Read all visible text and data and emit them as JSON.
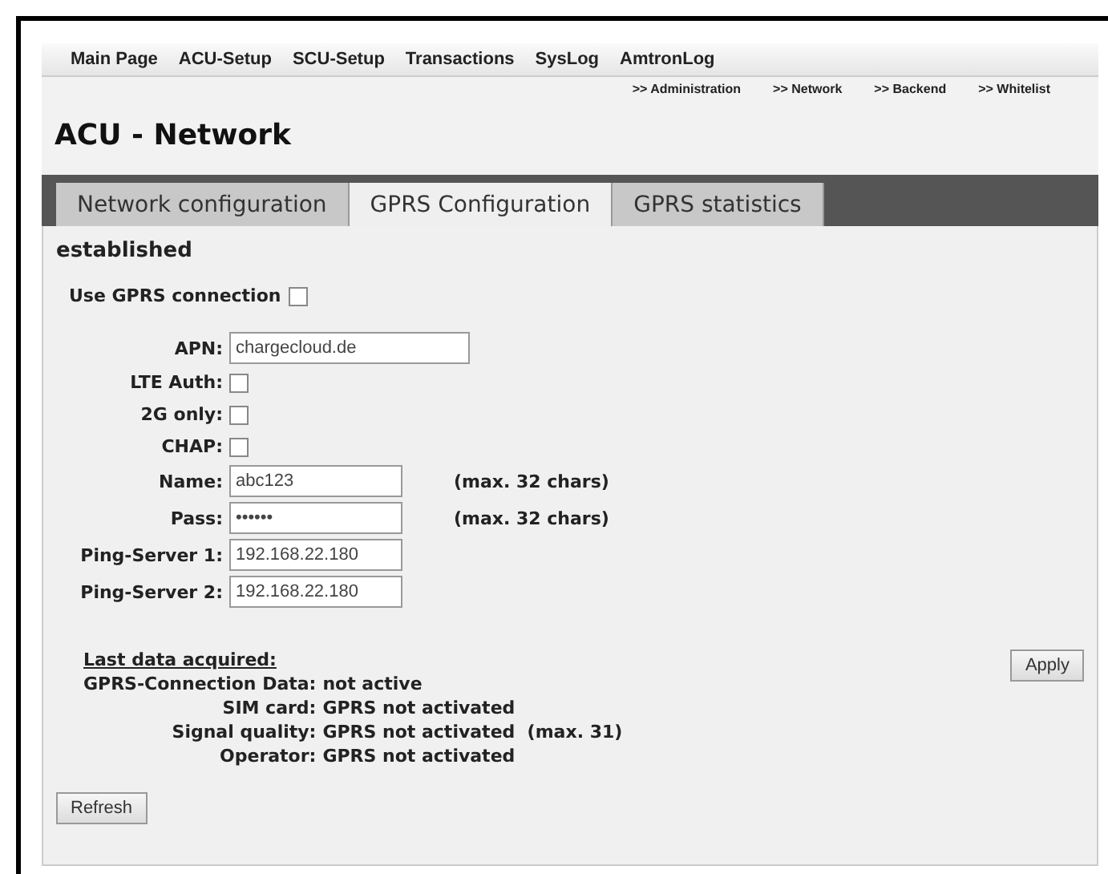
{
  "main_nav": [
    "Main Page",
    "ACU-Setup",
    "SCU-Setup",
    "Transactions",
    "SysLog",
    "AmtronLog"
  ],
  "sub_nav": [
    ">> Administration",
    ">> Network",
    ">> Backend",
    ">> Whitelist"
  ],
  "page_title": "ACU - Network",
  "tabs": [
    {
      "label": "Network configuration",
      "selected": false
    },
    {
      "label": "GPRS Configuration",
      "selected": true
    },
    {
      "label": "GPRS statistics",
      "selected": false
    }
  ],
  "status": "established",
  "use_gprs": {
    "label": "Use GPRS connection",
    "checked": false
  },
  "fields": [
    {
      "kind": "text",
      "label": "APN:",
      "value": "chargecloud.de",
      "wide": true
    },
    {
      "kind": "checkbox",
      "label": "LTE Auth:",
      "checked": false
    },
    {
      "kind": "checkbox",
      "label": "2G only:",
      "checked": false
    },
    {
      "kind": "checkbox",
      "label": "CHAP:",
      "checked": false
    },
    {
      "kind": "text",
      "label": "Name:",
      "value": "abc123",
      "hint": "(max. 32 chars)"
    },
    {
      "kind": "password",
      "label": "Pass:",
      "value": "••••••",
      "hint": "(max. 32 chars)"
    },
    {
      "kind": "text",
      "label": "Ping-Server 1:",
      "value": "192.168.22.180"
    },
    {
      "kind": "text",
      "label": "Ping-Server 2:",
      "value": "192.168.22.180"
    }
  ],
  "last_data": {
    "heading": "Last data acquired:",
    "rows": [
      {
        "label": "GPRS-Connection Data:",
        "value": "not active"
      },
      {
        "label": "SIM card:",
        "value": "GPRS not activated"
      },
      {
        "label": "Signal quality:",
        "value": "GPRS not activated  (max. 31)"
      },
      {
        "label": "Operator:",
        "value": "GPRS not activated"
      }
    ]
  },
  "apply_button": "Apply",
  "refresh_button": "Refresh"
}
